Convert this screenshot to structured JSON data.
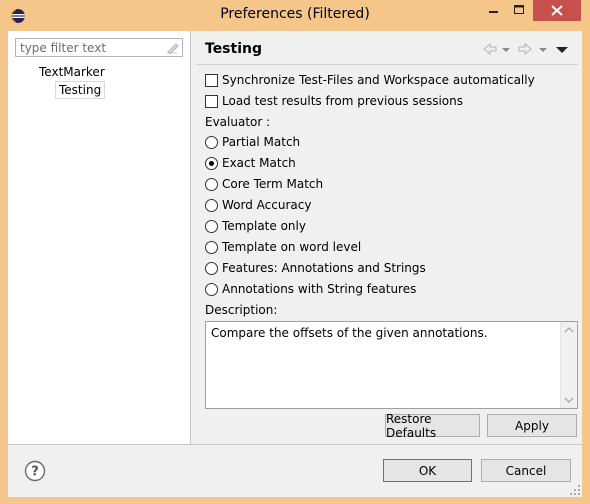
{
  "window": {
    "title": "Preferences (Filtered)",
    "frame_color": "#f4c68a",
    "close_color": "#c7504c"
  },
  "filter": {
    "placeholder": "type filter text"
  },
  "tree": {
    "parent": "TextMarker",
    "child": "Testing"
  },
  "page": {
    "title": "Testing",
    "options": [
      {
        "label": "Synchronize Test-Files and Workspace automatically",
        "checked": false
      },
      {
        "label": "Load test results from previous sessions",
        "checked": false
      }
    ],
    "evaluator_label": "Evaluator :",
    "evaluators": [
      {
        "label": "Partial Match",
        "selected": false
      },
      {
        "label": "Exact Match",
        "selected": true
      },
      {
        "label": "Core Term Match",
        "selected": false
      },
      {
        "label": "Word Accuracy",
        "selected": false
      },
      {
        "label": "Template only",
        "selected": false
      },
      {
        "label": "Template on word level",
        "selected": false
      },
      {
        "label": "Features: Annotations and Strings",
        "selected": false
      },
      {
        "label": "Annotations with String features",
        "selected": false
      }
    ],
    "description_label": "Description:",
    "description_text": "Compare the offsets of the given annotations.",
    "restore_defaults_label": "Restore Defaults",
    "apply_label": "Apply"
  },
  "footer": {
    "ok_label": "OK",
    "cancel_label": "Cancel"
  },
  "icons": {
    "app": "eclipse-icon",
    "clear": "clear-filter-icon",
    "back": "back-arrow-icon",
    "forward": "forward-arrow-icon",
    "view_menu": "view-menu-icon",
    "help": "help-icon"
  }
}
